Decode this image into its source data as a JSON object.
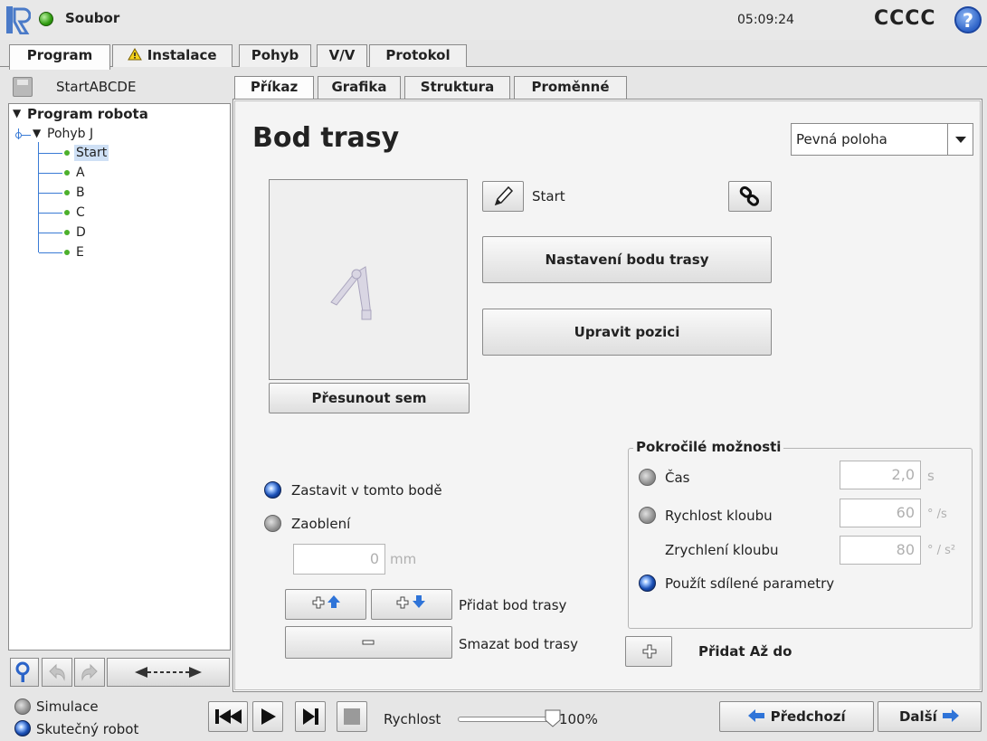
{
  "titlebar": {
    "menu_label": "Soubor",
    "clock": "05:09:24",
    "robot_name": "CCCC",
    "help_symbol": "?"
  },
  "main_tabs": [
    {
      "label": "Program",
      "active": true
    },
    {
      "label": "Instalace",
      "icon": "warning-icon"
    },
    {
      "label": "Pohyb"
    },
    {
      "label": "V/V"
    },
    {
      "label": "Protokol"
    }
  ],
  "file": {
    "name": "StartABCDE"
  },
  "tree": {
    "root": "Program robota",
    "move": "Pohyb J",
    "nodes": [
      "Start",
      "A",
      "B",
      "C",
      "D",
      "E"
    ],
    "selected": "Start"
  },
  "sub_tabs": [
    {
      "label": "Příkaz",
      "active": true
    },
    {
      "label": "Grafika"
    },
    {
      "label": "Struktura"
    },
    {
      "label": "Proměnné"
    }
  ],
  "command": {
    "title": "Bod trasy",
    "position_type": "Pevná poloha",
    "waypoint_name": "Start",
    "setup_button": "Nastavení bodu trasy",
    "edit_pose_button": "Upravit pozici",
    "move_here_button": "Přesunout sem"
  },
  "stop_options": {
    "stop_label": "Zastavit v tomto bodě",
    "blend_label": "Zaoblení",
    "blend_value": "0",
    "blend_unit": "mm",
    "selected": "stop"
  },
  "waypoint_actions": {
    "add_label": "Přidat bod trasy",
    "delete_label": "Smazat bod trasy"
  },
  "advanced": {
    "title": "Pokročilé možnosti",
    "time_label": "Čas",
    "time_value": "2,0",
    "time_unit": "s",
    "joint_speed_label": "Rychlost kloubu",
    "joint_speed_value": "60",
    "joint_speed_unit": "° /s",
    "joint_accel_label": "Zrychlení kloubu",
    "joint_accel_value": "80",
    "joint_accel_unit": "° / s²",
    "shared_label": "Použít sdílené parametry",
    "selected": "shared"
  },
  "until": {
    "label": "Přidat Až do"
  },
  "bottom": {
    "simulation_label": "Simulace",
    "real_robot_label": "Skutečný robot",
    "mode_selected": "real",
    "speed_label": "Rychlost",
    "speed_value": "100%",
    "speed_fraction": 1.0,
    "prev_button": "Předchozí",
    "next_button": "Další"
  },
  "colors": {
    "accent_blue": "#1a4fb5",
    "status_green": "#2f9c10",
    "tree_line": "#3a7bd5"
  }
}
